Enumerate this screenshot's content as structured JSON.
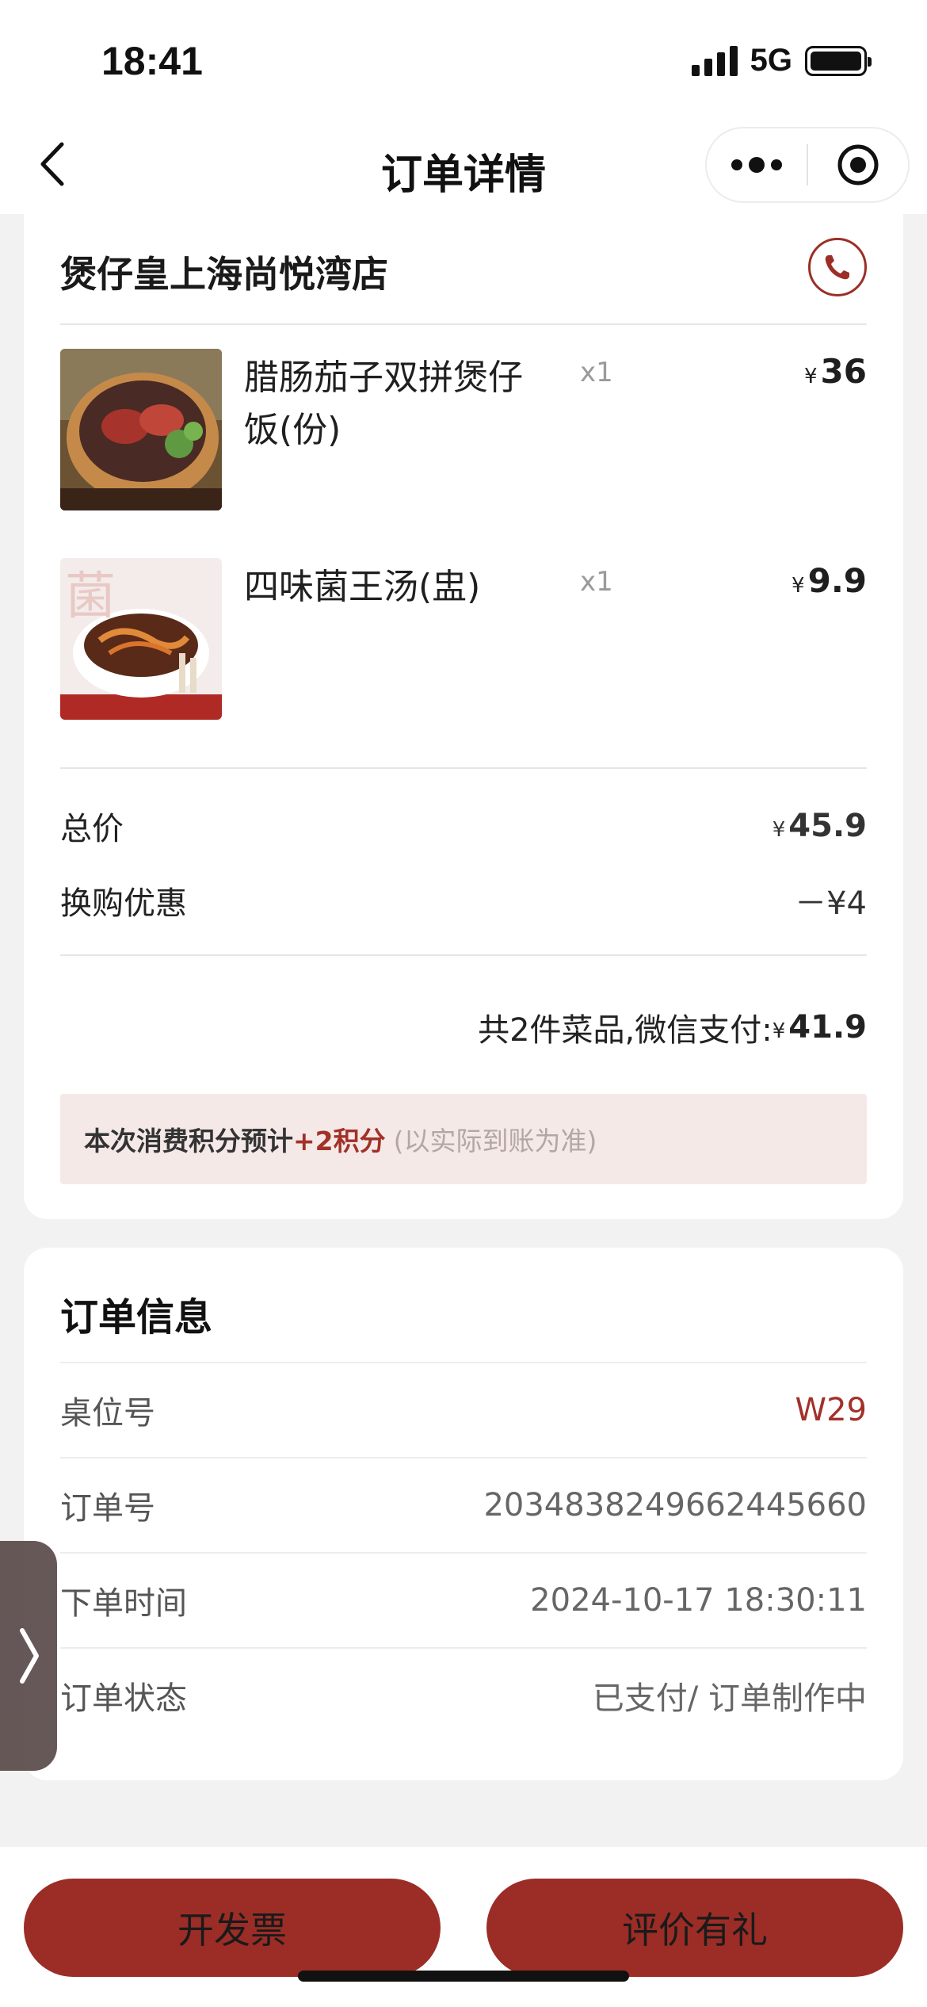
{
  "status_bar": {
    "time": "18:41",
    "network": "5G"
  },
  "nav": {
    "title": "订单详情",
    "menu_icon": "more-dots-icon",
    "close_icon": "target-circle-icon"
  },
  "store": {
    "name": "煲仔皇上海尚悦湾店"
  },
  "items": [
    {
      "name": "腊肠茄子双拼煲仔饭(份)",
      "qty": "x1",
      "currency": "¥",
      "price": "36"
    },
    {
      "name": "四味菌王汤(盅)",
      "qty": "x1",
      "currency": "¥",
      "price": "9.9"
    }
  ],
  "totals": {
    "total_label": "总价",
    "total_currency": "¥",
    "total_value": "45.9",
    "discount_label": "换购优惠",
    "discount_value": "－¥4"
  },
  "summary": {
    "text": "共2件菜品,微信支付:",
    "currency": "¥",
    "paid": "41.9"
  },
  "points": {
    "prefix": "本次消费积分预计",
    "amount": "+2积分",
    "note": "(以实际到账为准)"
  },
  "order_info": {
    "title": "订单信息",
    "rows": [
      {
        "label": "桌位号",
        "value": "W29"
      },
      {
        "label": "订单号",
        "value": "2034838249662445660"
      },
      {
        "label": "下单时间",
        "value": "2024-10-17 18:30:11"
      },
      {
        "label": "订单状态",
        "value": "已支付/ 订单制作中"
      }
    ]
  },
  "actions": {
    "invoice": "开发票",
    "review": "评价有礼"
  },
  "colors": {
    "accent": "#9b2d26",
    "points_bg": "#f5e9e8",
    "page_bg": "#f2f2f2"
  }
}
